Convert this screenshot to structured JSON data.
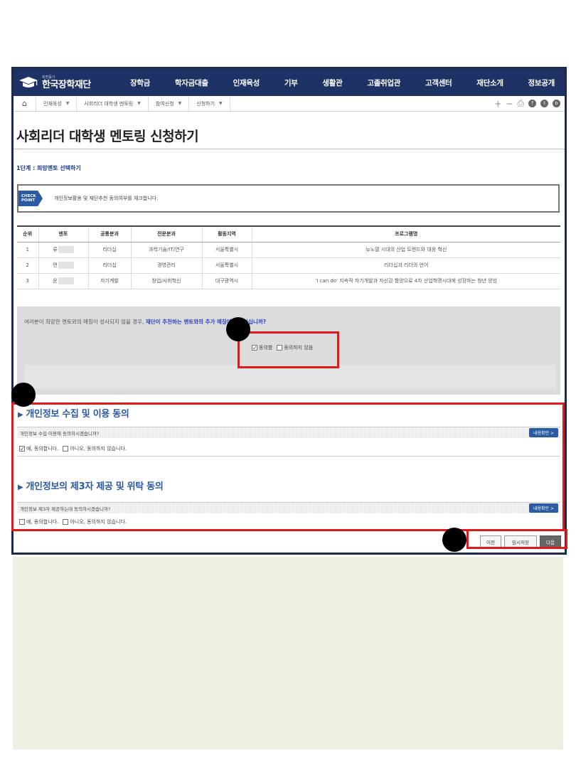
{
  "logo": {
    "subtitle": "희망동기",
    "name": "한국장학재단"
  },
  "nav": [
    "장학금",
    "학자금대출",
    "인재육성",
    "기부",
    "생활관",
    "고졸취업관",
    "고객센터",
    "재단소개",
    "정보공개"
  ],
  "breadcrumb": {
    "home_icon": "home-icon",
    "items": [
      "인재육성",
      "사회리더 대학생 멘토링",
      "참여신청",
      "신청하기"
    ]
  },
  "tools": {
    "plus": "+",
    "minus": "−",
    "print": "⎙",
    "c1": "f",
    "c2": "t",
    "c3": "b"
  },
  "page": {
    "title": "사회리더 대학생 멘토링 신청하기",
    "step": "1단계 : 희망멘토 선택하기"
  },
  "checkpoint": {
    "badge_line1": "CHECK",
    "badge_line2": "POINT",
    "text": "개인정보활용 및 재단추천 동의여부를 체크합니다."
  },
  "table": {
    "headers": [
      "순위",
      "멘토",
      "공통분과",
      "전문분과",
      "활동지역",
      "프로그램명"
    ],
    "rows": [
      [
        "1",
        "류",
        "리더십",
        "과학기술/IT/연구",
        "서울특별시",
        "뉴노멀 시대의 산업 트렌드와 대응 혁신"
      ],
      [
        "2",
        "편",
        "리더십",
        "경영관리",
        "서울특별시",
        "리더십과 리더의 언어"
      ],
      [
        "3",
        "윤",
        "자기계발",
        "창업/사회혁신",
        "대구광역시",
        "'I can do' 지속적 자기개발과 자신감 함양으로 4차 산업혁명시대에 성장하는 청년 양성"
      ]
    ]
  },
  "recommend": {
    "question_pre": "여러분이 희망한 멘토와의 매칭이 성사되지 않을 경우, ",
    "question_hl": "재단이 추천하는 멘토와의 추가 매칭에 동의하십니까?",
    "agree": "동의함",
    "disagree": "동의하지 않음"
  },
  "privacy": {
    "title": "개인정보 수집 및 이용 동의",
    "question": "개인정보 수집·이용에 동의하시겠습니까?",
    "detail": "내용확인 >",
    "yes": "예, 동의합니다.",
    "no": "아니오, 동의하지 않습니다."
  },
  "thirdparty": {
    "title": "개인정보의 제3자 제공 및 위탁 동의",
    "question": "개인정보 제3자 제공하는데 동의하시겠습니까?",
    "detail": "내용확인 >",
    "yes": "예, 동의합니다.",
    "no": "아니오, 동의하지 않습니다."
  },
  "buttons": {
    "prev": "이전",
    "save": "임시저장",
    "next": "다음"
  },
  "colors": {
    "nav_bg": "#1f3266",
    "highlight": "#e01a1a",
    "accent": "#2b5aa3"
  }
}
